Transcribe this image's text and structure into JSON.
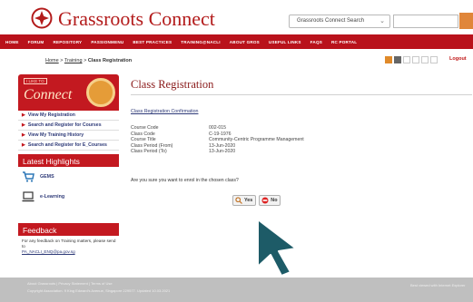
{
  "header": {
    "brand": "Grassroots Connect",
    "search_scope": "Grassroots Connect Search"
  },
  "nav": [
    "HOME",
    "FORUM",
    "REPOSITORY",
    "PASSIONMENU",
    "BEST PRACTICES",
    "TRAINING@NACLI",
    "ABOUT GROS",
    "USEFUL LINKS",
    "FAQS",
    "RC PORTAL"
  ],
  "breadcrumb": {
    "home": "Home",
    "sep1": ">",
    "training": "Training",
    "sep2": ">",
    "current": "Class Registration"
  },
  "toolbar": {
    "logout": "Logout"
  },
  "sidebar": {
    "lc_small": "I LIKE TO",
    "lc_big": "Connect",
    "links": [
      "View My Registration",
      "Search and Register for Courses",
      "View My Training History",
      "Search and Register for E_Courses"
    ],
    "latest_title": "Latest Highlights",
    "highlights": [
      "GEMS",
      "e-Learning"
    ],
    "feedback_title": "Feedback",
    "feedback_text": "For any feedback on Training matters, please send to",
    "feedback_email": "PA_NACLI_ENQ@pa.gov.sg"
  },
  "main": {
    "title": "Class Registration",
    "confirmation": "Class Registration Confirmation",
    "details": [
      {
        "k": "Course Code",
        "v": "002-015"
      },
      {
        "k": "Class Code",
        "v": "C-19-1976"
      },
      {
        "k": "Course Title",
        "v": "Community-Centric Programme Management"
      },
      {
        "k": "Class Period (From)",
        "v": "13-Jun-2020"
      },
      {
        "k": "Class Period (To)",
        "v": "13-Jun-2020"
      }
    ],
    "question": "Are you sure you want to enrol in the chosen class?",
    "yes": "Yes",
    "no": "No"
  },
  "footer": {
    "links": "About Grassroots | Privacy Statement | Terms of Use",
    "copyright": "Copyright Association. 9 King Edward's Avenue, Singapore 229577. Updated 10.03.2021",
    "right": "Best viewed with Internet Explorer"
  }
}
